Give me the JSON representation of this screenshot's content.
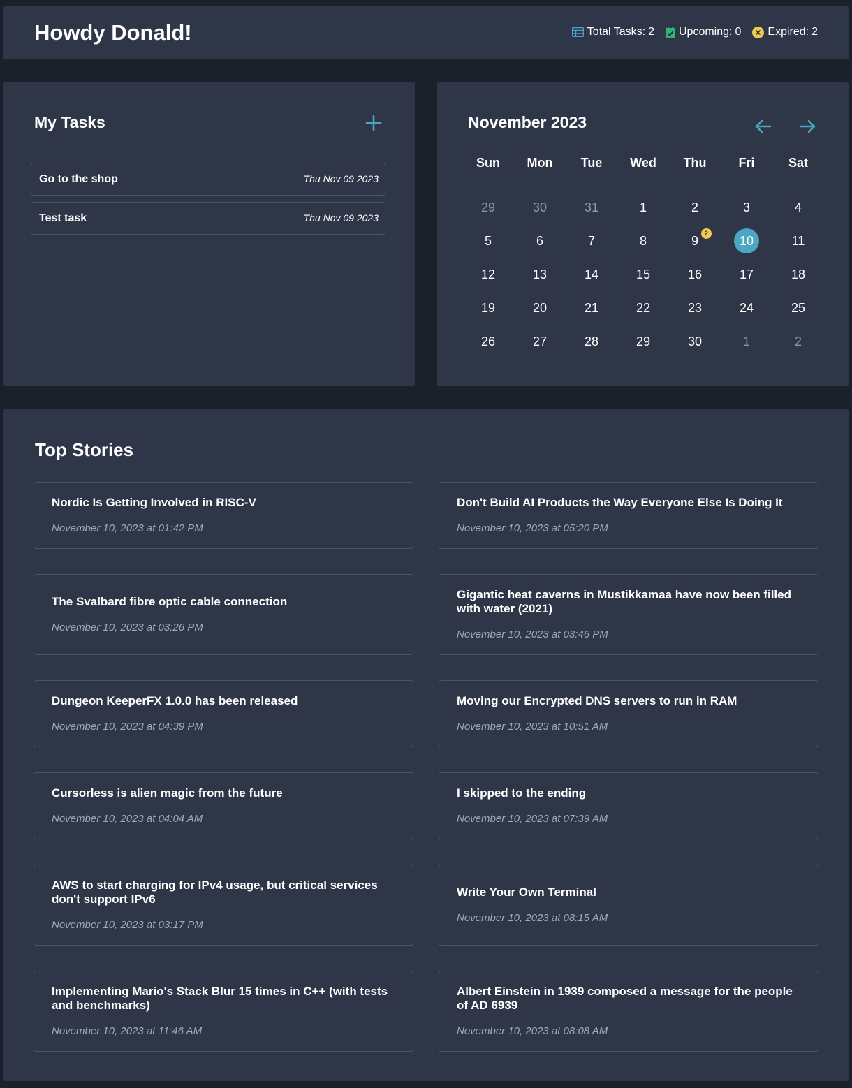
{
  "header": {
    "greeting": "Howdy Donald!",
    "stats": [
      {
        "label": "Total Tasks:",
        "value": "2",
        "icon": "table-icon",
        "color": "#4ba6c3"
      },
      {
        "label": "Upcoming:",
        "value": "0",
        "icon": "calendar-check-icon",
        "color": "#2bb673"
      },
      {
        "label": "Expired:",
        "value": "2",
        "icon": "x-circle-icon",
        "color": "#f2c94c"
      }
    ]
  },
  "tasks": {
    "title": "My Tasks",
    "add_icon": "plus-icon",
    "items": [
      {
        "title": "Go to the shop",
        "date": "Thu Nov 09 2023"
      },
      {
        "title": "Test task",
        "date": "Thu Nov 09 2023"
      }
    ]
  },
  "calendar": {
    "title": "November 2023",
    "prev_icon": "arrow-left-icon",
    "next_icon": "arrow-right-icon",
    "weekdays": [
      "Sun",
      "Mon",
      "Tue",
      "Wed",
      "Thu",
      "Fri",
      "Sat"
    ],
    "weeks": [
      [
        {
          "d": "29",
          "m": true
        },
        {
          "d": "30",
          "m": true
        },
        {
          "d": "31",
          "m": true
        },
        {
          "d": "1"
        },
        {
          "d": "2"
        },
        {
          "d": "3"
        },
        {
          "d": "4"
        }
      ],
      [
        {
          "d": "5"
        },
        {
          "d": "6"
        },
        {
          "d": "7"
        },
        {
          "d": "8"
        },
        {
          "d": "9",
          "badge": "2"
        },
        {
          "d": "10",
          "today": true
        },
        {
          "d": "11"
        }
      ],
      [
        {
          "d": "12"
        },
        {
          "d": "13"
        },
        {
          "d": "14"
        },
        {
          "d": "15"
        },
        {
          "d": "16"
        },
        {
          "d": "17"
        },
        {
          "d": "18"
        }
      ],
      [
        {
          "d": "19"
        },
        {
          "d": "20"
        },
        {
          "d": "21"
        },
        {
          "d": "22"
        },
        {
          "d": "23"
        },
        {
          "d": "24"
        },
        {
          "d": "25"
        }
      ],
      [
        {
          "d": "26"
        },
        {
          "d": "27"
        },
        {
          "d": "28"
        },
        {
          "d": "29"
        },
        {
          "d": "30"
        },
        {
          "d": "1",
          "m": true
        },
        {
          "d": "2",
          "m": true
        }
      ]
    ],
    "today_color": "#4ba6c3",
    "badge_color": "#f2c94c"
  },
  "stories": {
    "title": "Top Stories",
    "items": [
      {
        "title": "Nordic Is Getting Involved in RISC-V",
        "date": "November 10, 2023 at 01:42 PM"
      },
      {
        "title": "Don't Build AI Products the Way Everyone Else Is Doing It",
        "date": "November 10, 2023 at 05:20 PM"
      },
      {
        "title": "The Svalbard fibre optic cable connection",
        "date": "November 10, 2023 at 03:26 PM"
      },
      {
        "title": "Gigantic heat caverns in Mustikkamaa have now been filled with water (2021)",
        "date": "November 10, 2023 at 03:46 PM"
      },
      {
        "title": "Dungeon KeeperFX 1.0.0 has been released",
        "date": "November 10, 2023 at 04:39 PM"
      },
      {
        "title": "Moving our Encrypted DNS servers to run in RAM",
        "date": "November 10, 2023 at 10:51 AM"
      },
      {
        "title": "Cursorless is alien magic from the future",
        "date": "November 10, 2023 at 04:04 AM"
      },
      {
        "title": "I skipped to the ending",
        "date": "November 10, 2023 at 07:39 AM"
      },
      {
        "title": "AWS to start charging for IPv4 usage, but critical services don't support IPv6",
        "date": "November 10, 2023 at 03:17 PM"
      },
      {
        "title": "Write Your Own Terminal",
        "date": "November 10, 2023 at 08:15 AM"
      },
      {
        "title": "Implementing Mario's Stack Blur 15 times in C++ (with tests and benchmarks)",
        "date": "November 10, 2023 at 11:46 AM"
      },
      {
        "title": "Albert Einstein in 1939 composed a message for the people of AD 6939",
        "date": "November 10, 2023 at 08:08 AM"
      }
    ]
  }
}
